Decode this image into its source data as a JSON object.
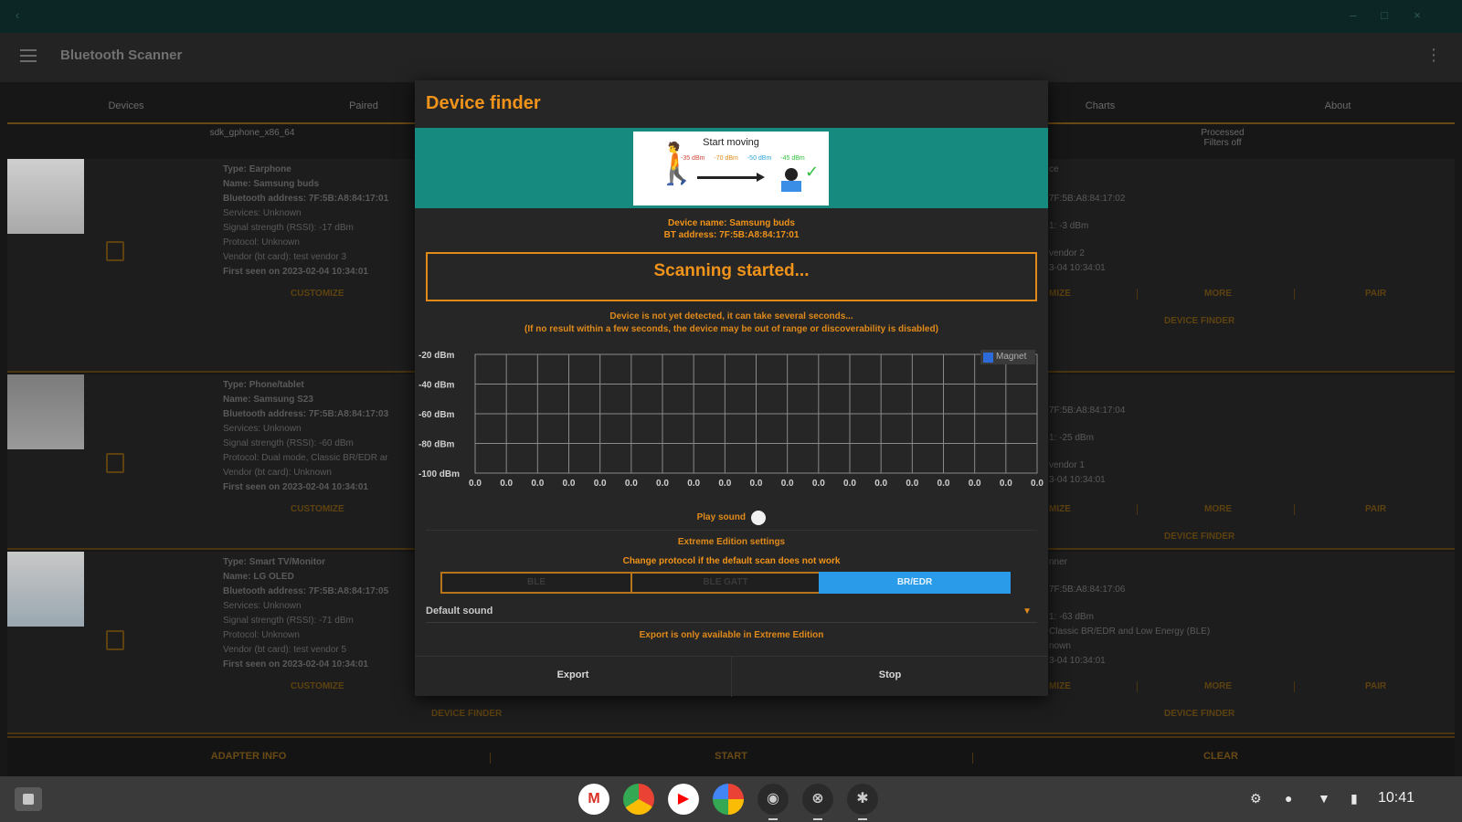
{
  "app": {
    "title": "Bluetooth Scanner",
    "tabs": [
      "Devices",
      "Paired",
      "Charts",
      "About"
    ],
    "subhead_left": "sdk_gphone_x86_64",
    "subhead_right": [
      "Processed",
      "Filters off"
    ],
    "rows": [
      {
        "info": [
          "Type: Earphone",
          "Name: Samsung buds",
          "Bluetooth address: 7F:5B:A8:84:17:01",
          "Services: Unknown",
          "Signal strength (RSSI): -17 dBm",
          "Protocol: Unknown",
          "Vendor (bt card): test vendor 3",
          "First seen on 2023-02-04 10:34:01"
        ],
        "right": [
          "ce",
          "7F:5B:A8:84:17:02",
          "1: -3 dBm",
          "",
          "vendor 2",
          "3-04 10:34:01"
        ]
      },
      {
        "info": [
          "Type: Phone/tablet",
          "Name: Samsung S23",
          "Bluetooth address: 7F:5B:A8:84:17:03",
          "Services: Unknown",
          "Signal strength (RSSI): -60 dBm",
          "Protocol: Dual mode, Classic BR/EDR ar",
          "Vendor (bt card): Unknown",
          "First seen on 2023-02-04 10:34:01"
        ],
        "right": [
          "",
          "7F:5B:A8:84:17:04",
          "1: -25 dBm",
          "",
          "vendor 1",
          "3-04 10:34:01"
        ]
      },
      {
        "info": [
          "Type: Smart TV/Monitor",
          "Name: LG OLED",
          "Bluetooth address: 7F:5B:A8:84:17:05",
          "Services: Unknown",
          "Signal strength (RSSI): -71 dBm",
          "Protocol: Unknown",
          "Vendor (bt card): test vendor 5",
          "First seen on 2023-02-04 10:34:01"
        ],
        "right": [
          "nner",
          "7F:5B:A8:84:17:06",
          "1: -63 dBm",
          "Classic BR/EDR and Low Energy (BLE)",
          "nown",
          "3-04 10:34:01"
        ]
      }
    ],
    "row_actions": {
      "customize": "CUSTOMIZE",
      "more": "MORE",
      "pair": "PAIR",
      "finder": "DEVICE FINDER",
      "cust_partial": "MIZE"
    },
    "bottom": [
      "ADAPTER INFO",
      "START",
      "CLEAR"
    ]
  },
  "dialog": {
    "title": "Device finder",
    "banner_text": "Start moving",
    "banner_nums": [
      "-35 dBm",
      "-70 dBm",
      "-50 dBm",
      "-45 dBm"
    ],
    "device_name": "Device name: Samsung buds",
    "bt_address": "BT address: 7F:5B:A8:84:17:01",
    "status": "Scanning started...",
    "note1": "Device is not yet detected, it can take several seconds...",
    "note2": "(If no result within a few seconds, the device may be out of range or discoverability is disabled)",
    "legend": "Magnet",
    "play_sound": "Play sound",
    "ee_title": "Extreme Edition settings",
    "ee_sub": "Change protocol if the default scan does not work",
    "protocols": [
      "BLE",
      "BLE GATT",
      "BR/EDR"
    ],
    "selected_protocol": "BR/EDR",
    "default_sound": "Default sound",
    "export_note": "Export is only available in Extreme Edition",
    "export": "Export",
    "stop": "Stop"
  },
  "chart_data": {
    "type": "line",
    "yticks": [
      "-20 dBm",
      "-40 dBm",
      "-60 dBm",
      "-80 dBm",
      "-100 dBm"
    ],
    "xticks": [
      "0.0",
      "0.0",
      "0.0",
      "0.0",
      "0.0",
      "0.0",
      "0.0",
      "0.0",
      "0.0",
      "0.0",
      "0.0",
      "0.0",
      "0.0",
      "0.0",
      "0.0",
      "0.0",
      "0.0",
      "0.0",
      "0.0"
    ],
    "ylim": [
      -100,
      -20
    ],
    "series": [
      {
        "name": "Magnet",
        "values": []
      }
    ],
    "grid": true,
    "legend": "top-right"
  },
  "shelf": {
    "apps": [
      "Gmail",
      "Chrome",
      "YouTube",
      "Photos",
      "App",
      "App",
      "App"
    ],
    "time": "10:41"
  },
  "colors": {
    "accent": "#f0931a",
    "teal": "#168a7e",
    "selected": "#2a9be8"
  }
}
